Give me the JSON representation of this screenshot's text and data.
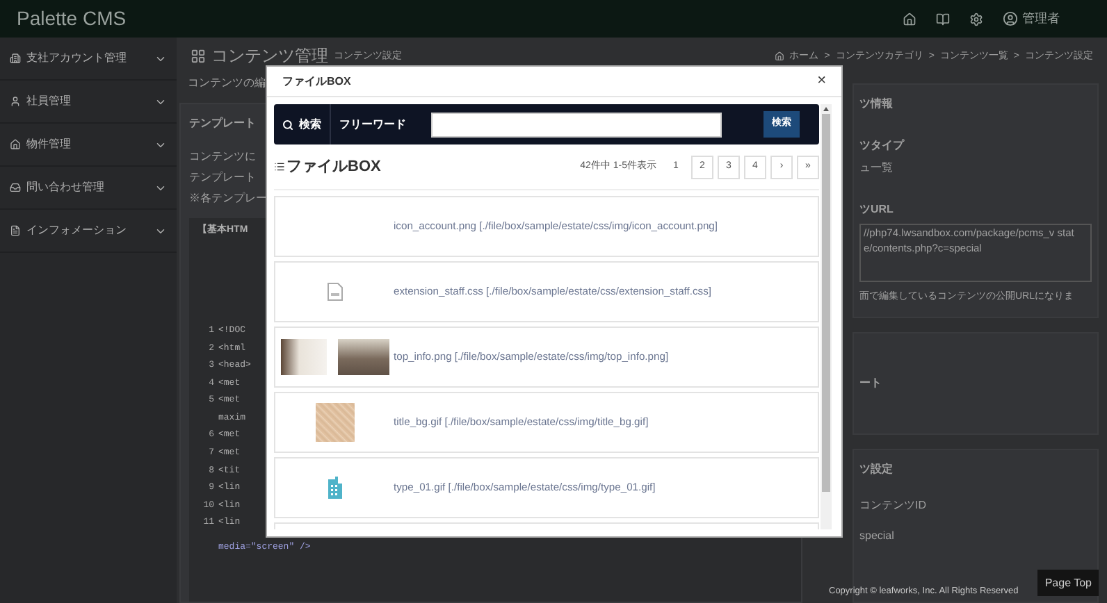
{
  "header": {
    "logo": "Palette CMS",
    "user": "管理者"
  },
  "sidebar": {
    "items": [
      {
        "label": "支社アカウント管理",
        "kind": "building"
      },
      {
        "label": "社員管理",
        "kind": "person"
      },
      {
        "label": "物件管理",
        "kind": "house"
      },
      {
        "label": "問い合わせ管理",
        "kind": "inbox"
      },
      {
        "label": "インフォメーション",
        "kind": "document"
      }
    ]
  },
  "page": {
    "title": "コンテンツ管理",
    "subtitle": "コンテンツ設定",
    "intro": "コンテンツの編",
    "breadcrumb": [
      "ホーム",
      "コンテンツカテゴリ",
      "コンテンツ一覧",
      "コンテンツ設定"
    ],
    "breadcrumb_separator": ">"
  },
  "template_panel": {
    "title": "テンプレート",
    "lines": [
      "コンテンツに",
      "テンプレート",
      "※各テンプレー"
    ],
    "tab": "【基本HTM",
    "code": [
      {
        "number": "1",
        "text": "<!DOC"
      },
      {
        "number": "2",
        "text": "<html"
      },
      {
        "number": "3",
        "text": "<head>"
      },
      {
        "number": "4",
        "text": "<met"
      },
      {
        "number": "5",
        "text": "<met"
      },
      {
        "text": "maxim"
      },
      {
        "number": "6",
        "text": "<met"
      },
      {
        "number": "7",
        "text": "<met"
      },
      {
        "number": "8",
        "text": "<tit"
      },
      {
        "number": "9",
        "text": "<lin"
      },
      {
        "number": "10",
        "text": "<lin"
      },
      {
        "number": "11",
        "text": "<lin"
      }
    ],
    "code_tail": "media=\"screen\" />"
  },
  "info_panel": {
    "title": "ツ情報",
    "type_label": "ツタイプ",
    "type_value": "ュ一覧",
    "url_label": "ツURL",
    "url_value": "//php74.lwsandbox.com/package/pcms_v state/contents.php?c=special",
    "note": "面で編集しているコンテンツの公開URLになりま"
  },
  "second_panel": {
    "title": "ート"
  },
  "settings_panel": {
    "title": "ツ設定",
    "id_label": "コンテンツID",
    "id_value": "special"
  },
  "footer": {
    "copyright": "Copyright © leafworks, Inc. All Rights Reserved",
    "page_top": "Page Top"
  },
  "modal": {
    "title": "ファイルBOX",
    "close": "×",
    "search": {
      "label": "検索",
      "field_label": "フリーワード",
      "button": "検索"
    },
    "list_title": "ファイルBOX",
    "count": "42件中 1-5件表示",
    "pages": [
      {
        "label": "1",
        "selected": true
      },
      {
        "label": "2",
        "selected": false
      },
      {
        "label": "3",
        "selected": false
      },
      {
        "label": "4",
        "selected": false
      },
      {
        "label": "›",
        "selected": false
      },
      {
        "label": "»",
        "selected": false
      }
    ],
    "files": [
      {
        "kind": "blank",
        "text": "icon_account.png [./file/box/sample/estate/css/img/icon_account.png]"
      },
      {
        "kind": "css",
        "text": "extension_staff.css [./file/box/sample/estate/css/extension_staff.css]"
      },
      {
        "kind": "photo",
        "text": "top_info.png [./file/box/sample/estate/css/img/top_info.png]"
      },
      {
        "kind": "texture",
        "text": "title_bg.gif [./file/box/sample/estate/css/img/title_bg.gif]"
      },
      {
        "kind": "building",
        "text": "type_01.gif [./file/box/sample/estate/css/img/type_01.gif]"
      }
    ]
  }
}
